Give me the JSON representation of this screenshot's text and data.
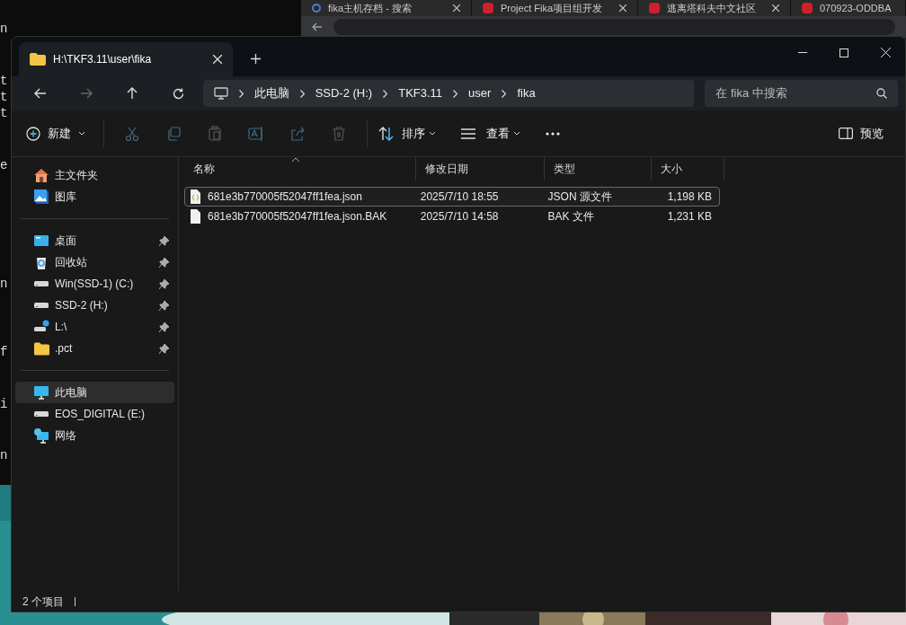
{
  "background": {
    "terminal_lines": [
      "n",
      "t",
      "t",
      "t",
      "e",
      "n",
      "f",
      "i",
      "n"
    ],
    "browser_tabs": [
      {
        "kind": "search",
        "title": "fika主机存档 - 搜索"
      },
      {
        "kind": "site",
        "title": "Project Fika项目组开发"
      },
      {
        "kind": "site",
        "title": "逃离塔科夫中文社区"
      },
      {
        "kind": "site",
        "title": "070923-ODDBA"
      }
    ]
  },
  "window": {
    "tab": {
      "title": "H:\\TKF3.11\\user\\fika"
    },
    "breadcrumbs": [
      "此电脑",
      "SSD-2 (H:)",
      "TKF3.11",
      "user",
      "fika"
    ],
    "search": {
      "placeholder": "在 fika 中搜索"
    },
    "toolbar": {
      "new": "新建",
      "actions": [
        {
          "kind": "cut",
          "disabled": true
        },
        {
          "kind": "copy",
          "disabled": true
        },
        {
          "kind": "paste",
          "disabled": true
        },
        {
          "kind": "rename",
          "disabled": true
        },
        {
          "kind": "share",
          "disabled": true
        },
        {
          "kind": "delete",
          "disabled": true
        }
      ],
      "sort": "排序",
      "view": "查看",
      "preview": "预览"
    },
    "sidebar": {
      "sections": [
        [
          {
            "kind": "home",
            "label": "主文件夹",
            "pinned": false,
            "selected": false
          },
          {
            "kind": "gallery",
            "label": "图库",
            "pinned": false,
            "selected": false
          }
        ],
        [
          {
            "kind": "desktop",
            "label": "桌面",
            "pinned": true,
            "selected": false
          },
          {
            "kind": "recycle",
            "label": "回收站",
            "pinned": true,
            "selected": false
          },
          {
            "kind": "drive",
            "label": "Win(SSD-1) (C:)",
            "pinned": true,
            "selected": false
          },
          {
            "kind": "drive",
            "label": "SSD-2 (H:)",
            "pinned": true,
            "selected": false
          },
          {
            "kind": "netdrive",
            "label": "L:\\",
            "pinned": true,
            "selected": false
          },
          {
            "kind": "folder",
            "label": ".pct",
            "pinned": true,
            "selected": false
          }
        ],
        [
          {
            "kind": "pc",
            "label": "此电脑",
            "pinned": false,
            "selected": true
          },
          {
            "kind": "drive",
            "label": "EOS_DIGITAL (E:)",
            "pinned": false,
            "selected": false
          },
          {
            "kind": "network",
            "label": "网络",
            "pinned": false,
            "selected": false
          }
        ]
      ]
    },
    "columns": [
      "名称",
      "修改日期",
      "类型",
      "大小"
    ],
    "files": [
      {
        "kind": "json",
        "name": "681e3b770005f52047ff1fea.json",
        "date": "2025/7/10 18:55",
        "type": "JSON 源文件",
        "size": "1,198 KB",
        "selected": true
      },
      {
        "kind": "file",
        "name": "681e3b770005f52047ff1fea.json.BAK",
        "date": "2025/7/10 14:58",
        "type": "BAK 文件",
        "size": "1,231 KB",
        "selected": false
      }
    ],
    "status": "2 个项目"
  }
}
